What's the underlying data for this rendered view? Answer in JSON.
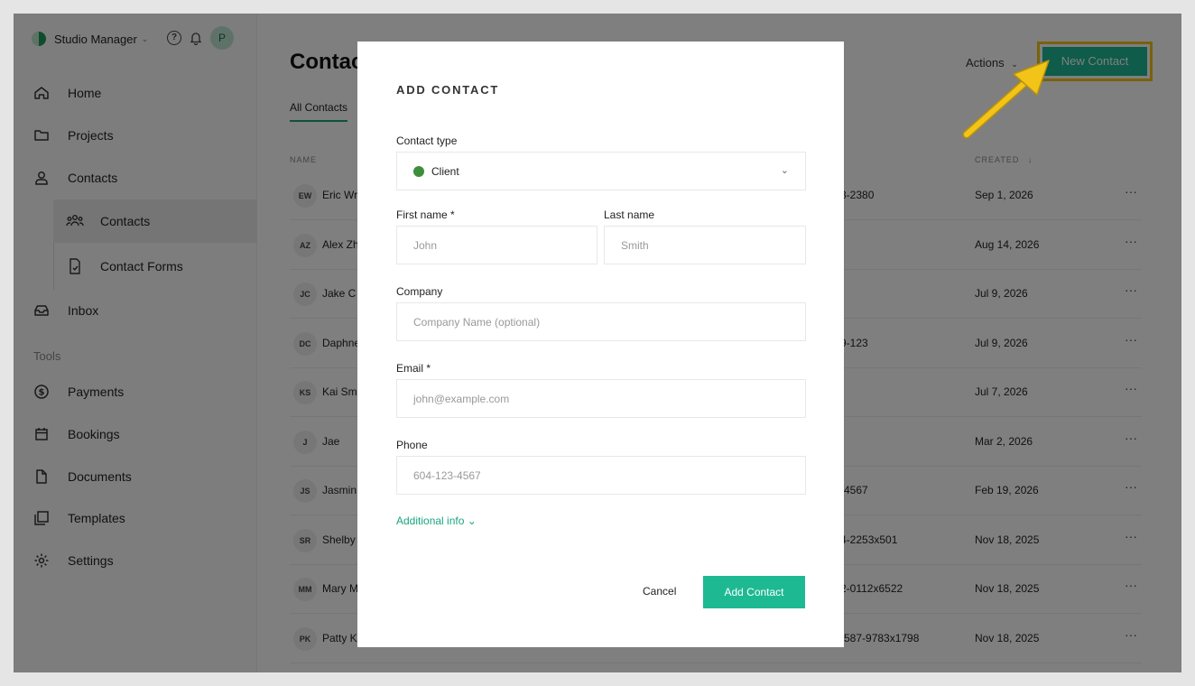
{
  "brand": {
    "name": "Studio Manager",
    "caret": "⌄",
    "avatar": "P"
  },
  "sidebar": {
    "items": [
      {
        "label": "Home",
        "icon": "home-icon"
      },
      {
        "label": "Projects",
        "icon": "folder-icon"
      },
      {
        "label": "Contacts",
        "icon": "user-icon"
      },
      {
        "label": "Contacts",
        "icon": "people-icon"
      },
      {
        "label": "Contact Forms",
        "icon": "form-icon"
      },
      {
        "label": "Inbox",
        "icon": "inbox-icon"
      },
      {
        "label": "Payments",
        "icon": "dollar-icon"
      },
      {
        "label": "Bookings",
        "icon": "calendar-icon"
      },
      {
        "label": "Documents",
        "icon": "document-icon"
      },
      {
        "label": "Templates",
        "icon": "templates-icon"
      },
      {
        "label": "Settings",
        "icon": "gear-icon"
      }
    ],
    "tools_label": "Tools"
  },
  "main": {
    "title": "Contac",
    "tab": "All Contacts",
    "actions_label": "Actions",
    "actions_caret": "⌄",
    "new_contact_label": "New Contact",
    "col_name": "NAME",
    "col_created": "CREATED",
    "col_created_arrow": "↓",
    "more": "···",
    "rows": [
      {
        "initials": "EW",
        "name": "Eric Wr",
        "phone": "3-2380",
        "created": "Sep 1, 2026"
      },
      {
        "initials": "AZ",
        "name": "Alex Zh",
        "phone": "",
        "created": "Aug 14, 2026"
      },
      {
        "initials": "JC",
        "name": "Jake C",
        "phone": "",
        "created": "Jul 9, 2026"
      },
      {
        "initials": "DC",
        "name": "Daphne",
        "phone": "9-123",
        "created": "Jul 9, 2026"
      },
      {
        "initials": "KS",
        "name": "Kai Sm",
        "phone": "",
        "created": "Jul 7, 2026"
      },
      {
        "initials": "J",
        "name": "Jae",
        "phone": "",
        "created": "Mar 2, 2026"
      },
      {
        "initials": "JS",
        "name": "Jasmin",
        "phone": "-4567",
        "created": "Feb 19, 2026"
      },
      {
        "initials": "SR",
        "name": "Shelby",
        "phone": "4-2253x501",
        "created": "Nov 18, 2025"
      },
      {
        "initials": "MM",
        "name": "Mary M",
        "phone": "2-0112x6522",
        "created": "Nov 18, 2025"
      },
      {
        "initials": "PK",
        "name": "Patty K",
        "phone": "-587-9783x1798",
        "created": "Nov 18, 2025"
      }
    ]
  },
  "modal": {
    "title": "ADD CONTACT",
    "contact_type_label": "Contact type",
    "contact_type_value": "Client",
    "contact_type_caret": "⌄",
    "first_name_label": "First name *",
    "first_name_placeholder": "John",
    "last_name_label": "Last name",
    "last_name_placeholder": "Smith",
    "company_label": "Company",
    "company_placeholder": "Company Name (optional)",
    "email_label": "Email *",
    "email_placeholder": "john@example.com",
    "phone_label": "Phone",
    "phone_placeholder": "604-123-4567",
    "additional_info": "Additional info ⌄",
    "cancel_label": "Cancel",
    "add_label": "Add Contact"
  },
  "colors": {
    "accent": "#1db992",
    "highlight": "#f2c417",
    "client_dot": "#3d8f3b"
  }
}
